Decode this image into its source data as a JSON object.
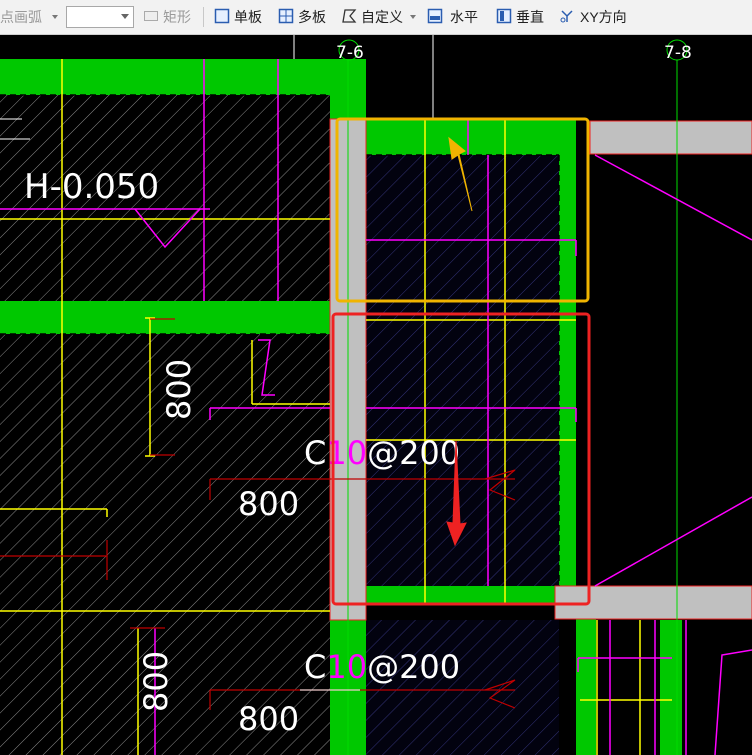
{
  "toolbar": {
    "arc_label": "点画弧",
    "combo_value": "",
    "rect_label": "矩形",
    "single_slab_label": "单板",
    "multi_slab_label": "多板",
    "custom_label": "自定义",
    "horizontal_label": "水平",
    "vertical_label": "垂直",
    "xy_label": "XY方向"
  },
  "drawing": {
    "axis_left": "7-6",
    "axis_right": "7-8",
    "elevation": "H-0.050",
    "dim_vertical_top": "800",
    "dim_horizontal_mid": "800",
    "rebar_mid_pre": "C",
    "rebar_mid_num": "10",
    "rebar_mid_post": "@200",
    "dim_vertical_bottom": "800",
    "rebar_bottom_pre": "C",
    "rebar_bottom_num": "10",
    "rebar_bottom_post": "@200",
    "dim_horizontal_bottom": "800"
  },
  "colors": {
    "slab_green": "#00c800",
    "wall_gray": "#c0c0c0",
    "guide_yellow": "#ffff00",
    "rebar_magenta": "#ff00ff",
    "highlight_orange": "#f0b400",
    "highlight_red": "#ee2222",
    "axis_green": "#00dd00"
  }
}
